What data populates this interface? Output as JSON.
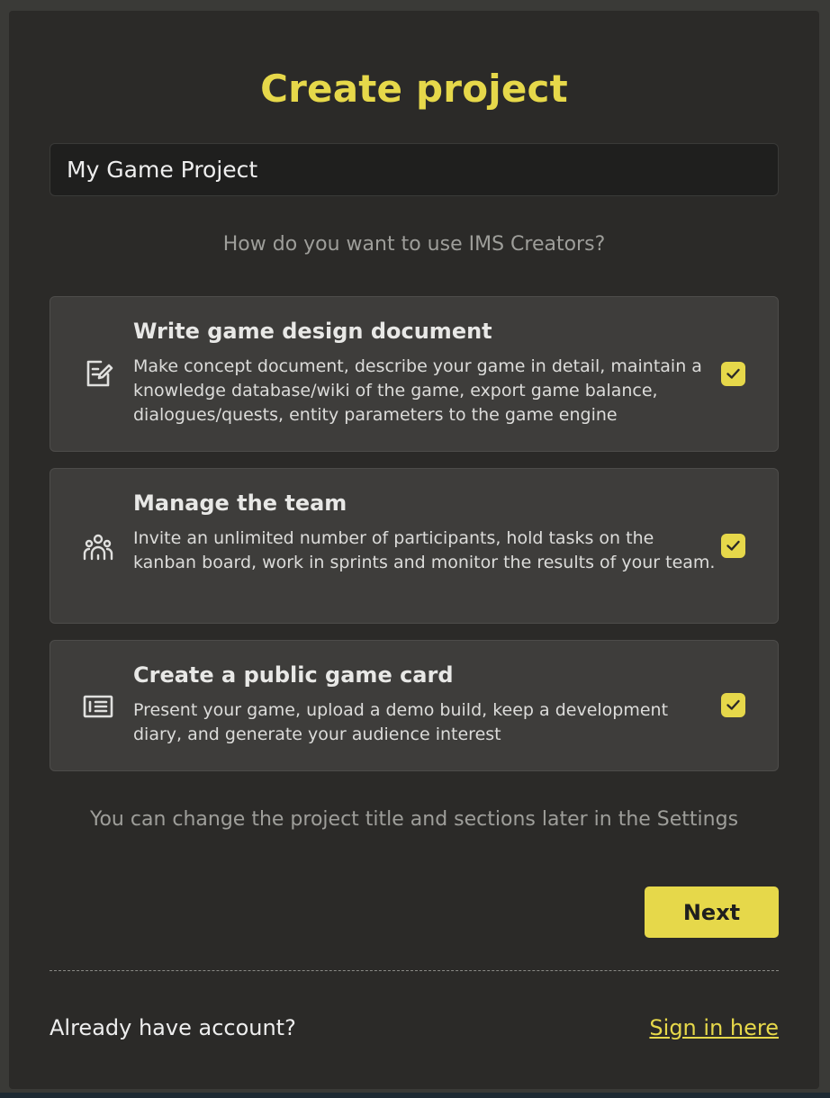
{
  "page": {
    "title": "Create project"
  },
  "project_name": {
    "value": "My Game Project"
  },
  "question": "How do you want to use IMS Creators?",
  "options": [
    {
      "icon": "edit-document-icon",
      "title": "Write game design document",
      "description": "Make concept document, describe your game in detail, maintain a knowledge database/wiki of the game, export game balance, dialogues/quests, entity parameters to the game engine",
      "checked": true
    },
    {
      "icon": "team-icon",
      "title": "Manage the team",
      "description": "Invite an unlimited number of participants, hold tasks on the kanban board, work in sprints and monitor the results of your team.",
      "checked": true
    },
    {
      "icon": "id-card-icon",
      "title": "Create a public game card",
      "description": "Present your game, upload a demo build, keep a development diary, and generate your audience interest",
      "checked": true
    }
  ],
  "note": "You can change the project title and sections later in the Settings",
  "next_label": "Next",
  "footer": {
    "question": "Already have account?",
    "link": "Sign in here"
  },
  "colors": {
    "accent": "#e6d84a",
    "panel": "#2b2a28",
    "card": "#3e3d3b"
  }
}
